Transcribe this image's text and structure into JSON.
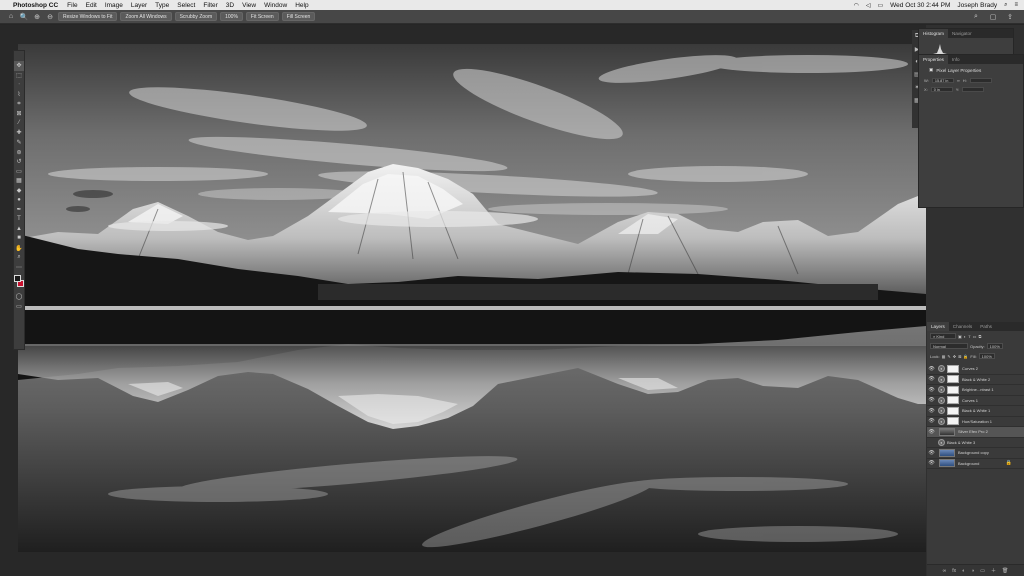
{
  "menubar": {
    "apple": "",
    "app_name": "Photoshop CC",
    "items": [
      "File",
      "Edit",
      "Image",
      "Layer",
      "Type",
      "Select",
      "Filter",
      "3D",
      "View",
      "Window",
      "Help"
    ],
    "clock": "Wed Oct 30  2:44 PM",
    "user": "Joseph Brady",
    "search_glyph": "⌕",
    "list_glyph": "≡"
  },
  "options_bar": {
    "home_glyph": "⌂",
    "zoom_glyph": "🔍",
    "zoom_in_glyph": "⊕",
    "zoom_out_glyph": "⊖",
    "buttons": [
      "Resize Windows to Fit",
      "Zoom All Windows",
      "Scrubby Zoom",
      "100%",
      "Fit Screen",
      "Fill Screen"
    ]
  },
  "toolbar": {
    "tools": [
      "move",
      "marquee",
      "lasso",
      "quick-select",
      "crop",
      "frame",
      "eyedropper",
      "healing",
      "brush",
      "clone",
      "history",
      "eraser",
      "gradient",
      "blur",
      "dodge",
      "pen",
      "type",
      "path-select",
      "shape",
      "hand",
      "zoom",
      "more"
    ],
    "glyphs": [
      "✥",
      "⬚",
      "ᐧ",
      "⌇",
      "⌗",
      "⊠",
      "⁄",
      "✚",
      "✎",
      "⊛",
      "↺",
      "▭",
      "▦",
      "◆",
      "●",
      "✒",
      "T",
      "▲",
      "■",
      "✋",
      "⌕",
      "⋯"
    ],
    "fg_color": "#1a1a1a",
    "bg_color": "#c8102e"
  },
  "histogram_panel": {
    "tabs": [
      "Histogram",
      "Navigator"
    ]
  },
  "properties_panel": {
    "tabs": [
      "Properties",
      "Info"
    ],
    "title": "Pixel Layer Properties",
    "w_label": "W:",
    "w_value": "15.87 in",
    "h_label": "H:",
    "x_label": "X:",
    "x_value": "0 in",
    "y_label": "Y:",
    "link_glyph": "∞"
  },
  "layers_panel": {
    "tabs": [
      "Layers",
      "Channels",
      "Paths"
    ],
    "kind_label": "Kind",
    "blend_mode": "Normal",
    "opacity_label": "Opacity:",
    "opacity_value": "100%",
    "lock_label": "Lock:",
    "fill_label": "Fill:",
    "fill_value": "100%",
    "layers": [
      {
        "name": "Curves 2",
        "type": "adjustment",
        "visible": true
      },
      {
        "name": "Black & White 2",
        "type": "adjustment",
        "visible": true
      },
      {
        "name": "Brightne...ntrast 1",
        "type": "adjustment",
        "visible": true
      },
      {
        "name": "Curves 1",
        "type": "adjustment",
        "visible": true
      },
      {
        "name": "Black & White 1",
        "type": "adjustment",
        "visible": true
      },
      {
        "name": "Hue/Saturation 1",
        "type": "adjustment",
        "visible": true
      },
      {
        "name": "Silver Efex Pro 2",
        "type": "pixel",
        "visible": true,
        "selected": true
      },
      {
        "name": "Black & White 3",
        "type": "adjustment",
        "visible": false
      },
      {
        "name": "Background copy",
        "type": "image",
        "visible": true
      },
      {
        "name": "Background",
        "type": "image",
        "visible": true,
        "locked": true
      }
    ],
    "bottom_glyphs": [
      "∞",
      "fx",
      "◐",
      "◑",
      "▭",
      "＋",
      "🗑"
    ]
  }
}
